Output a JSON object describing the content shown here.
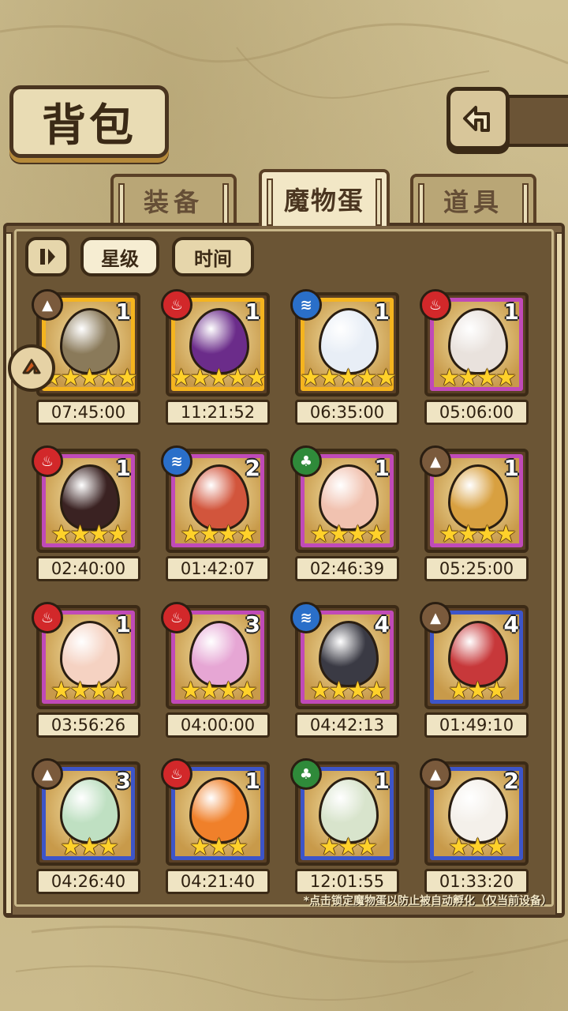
{
  "title": "背包",
  "tabs": [
    {
      "label": "装备",
      "active": false
    },
    {
      "label": "魔物蛋",
      "active": true
    },
    {
      "label": "道具",
      "active": false
    }
  ],
  "sort": {
    "toggle_icon": "sort-toggle-icon",
    "star_label": "星级",
    "time_label": "时间"
  },
  "eggs": [
    {
      "element": "earth",
      "count": "1",
      "stars": "★★★★★",
      "rarity": "gold",
      "time": "07:45:00"
    },
    {
      "element": "fire",
      "count": "1",
      "stars": "★★★★★",
      "rarity": "gold",
      "time": "11:21:52"
    },
    {
      "element": "water",
      "count": "1",
      "stars": "★★★★★",
      "rarity": "gold",
      "time": "06:35:00"
    },
    {
      "element": "fire",
      "count": "1",
      "stars": "★★★★",
      "rarity": "purple",
      "time": "05:06:00"
    },
    {
      "element": "fire",
      "count": "1",
      "stars": "★★★★",
      "rarity": "purple",
      "time": "02:40:00"
    },
    {
      "element": "water",
      "count": "2",
      "stars": "★★★★",
      "rarity": "purple",
      "time": "01:42:07"
    },
    {
      "element": "wood",
      "count": "1",
      "stars": "★★★★",
      "rarity": "purple",
      "time": "02:46:39"
    },
    {
      "element": "earth",
      "count": "1",
      "stars": "★★★★",
      "rarity": "purple",
      "time": "05:25:00"
    },
    {
      "element": "fire",
      "count": "1",
      "stars": "★★★★",
      "rarity": "purple",
      "time": "03:56:26"
    },
    {
      "element": "fire",
      "count": "3",
      "stars": "★★★★",
      "rarity": "purple",
      "time": "04:00:00"
    },
    {
      "element": "water",
      "count": "4",
      "stars": "★★★★",
      "rarity": "purple",
      "time": "04:42:13"
    },
    {
      "element": "earth",
      "count": "4",
      "stars": "★★★",
      "rarity": "blue",
      "time": "01:49:10"
    },
    {
      "element": "earth",
      "count": "3",
      "stars": "★★★",
      "rarity": "blue",
      "time": "04:26:40"
    },
    {
      "element": "fire",
      "count": "1",
      "stars": "★★★",
      "rarity": "blue",
      "time": "04:21:40"
    },
    {
      "element": "wood",
      "count": "1",
      "stars": "★★★",
      "rarity": "blue",
      "time": "12:01:55"
    },
    {
      "element": "earth",
      "count": "2",
      "stars": "★★★",
      "rarity": "blue",
      "time": "01:33:20"
    }
  ],
  "note": "*点击锁定魔物蛋以防止被自动孵化（仅当前设备）",
  "colors": {
    "gold": "#f5b41e",
    "purple": "#c04ab8",
    "blue": "#3d55c8",
    "fire": "#d2282a",
    "water": "#2a6fc9",
    "wood": "#2f8a3a",
    "earth": "#7a5a3c"
  }
}
